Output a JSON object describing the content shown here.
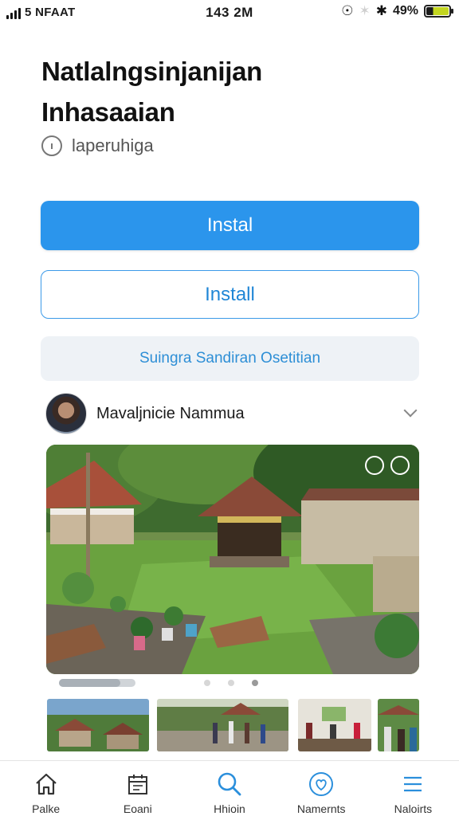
{
  "status_bar": {
    "carrier": "5 NFAAT",
    "time": "143 2M",
    "battery_percent": "49%"
  },
  "app": {
    "title_line1": "Natlalngsinjanijan",
    "title_line2": "Inhasaaian",
    "developer": "laperuhiga"
  },
  "buttons": {
    "primary_label": "Instal",
    "secondary_label": "Install",
    "tertiary_label": "Suingra Sandiran Osetitian"
  },
  "author": {
    "name": "Mavaljnicie Nammua"
  },
  "carousel": {
    "progress": 0.8,
    "dots": 3,
    "active_dot": 2
  },
  "bottom_nav": {
    "items": [
      {
        "label": "Palke",
        "icon": "home-icon"
      },
      {
        "label": "Eoani",
        "icon": "calendar-icon"
      },
      {
        "label": "Hhioin",
        "icon": "search-icon"
      },
      {
        "label": "Namernts",
        "icon": "heart-icon"
      },
      {
        "label": "Naloirts",
        "icon": "menu-icon"
      }
    ]
  },
  "colors": {
    "primary": "#2b95ec",
    "link": "#1f86d6",
    "tertiary_bg": "#eef2f6"
  }
}
